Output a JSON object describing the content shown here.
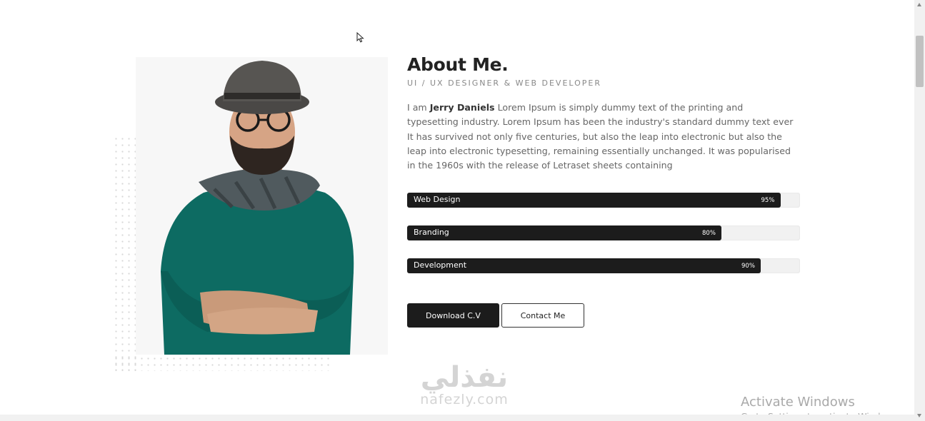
{
  "about": {
    "title": "About Me.",
    "subtitle": "UI / UX DESIGNER & WEB DEVELOPER",
    "bio_prefix": "I am ",
    "bio_name": "Jerry Daniels",
    "bio_text": " Lorem Ipsum is simply dummy text of the printing and typesetting industry. Lorem Ipsum has been the industry's standard dummy text ever It has survived not only five centuries, but also the leap into electronic but also the leap into electronic typesetting, remaining essentially unchanged. It was popularised in the 1960s with the release of Letraset sheets containing"
  },
  "skills": [
    {
      "label": "Web Design",
      "percent": 95,
      "percent_label": "95%"
    },
    {
      "label": "Branding",
      "percent": 80,
      "percent_label": "80%"
    },
    {
      "label": "Development",
      "percent": 90,
      "percent_label": "90%"
    }
  ],
  "buttons": {
    "download": "Download C.V",
    "contact": "Contact Me"
  },
  "watermark": {
    "arabic": "نفذلي",
    "latin": "nafezly.com"
  },
  "windows_notice": {
    "title": "Activate Windows",
    "subtitle": "Go to Settings to activate Windows."
  },
  "icons": {
    "cursor": "mouse-pointer-icon",
    "portrait": "portrait-photo"
  },
  "colors": {
    "accent": "#1c1c1c",
    "track": "#f1f1f1",
    "sweater": "#0d6b62"
  }
}
